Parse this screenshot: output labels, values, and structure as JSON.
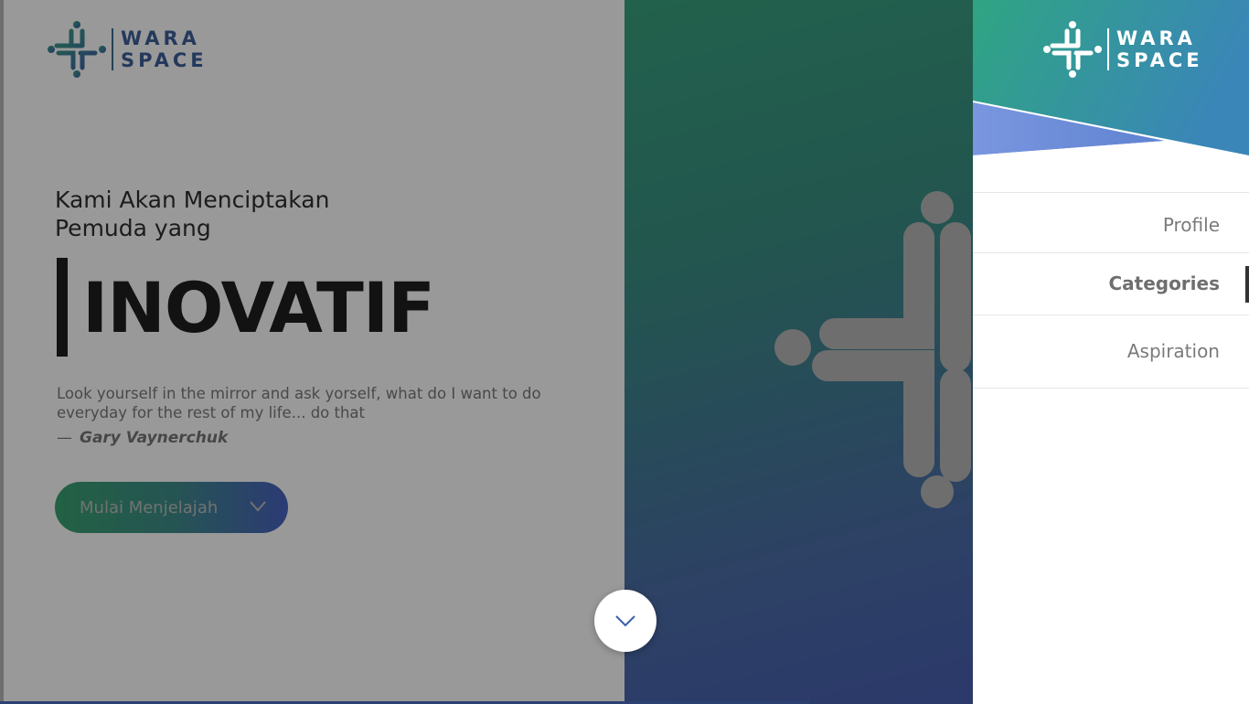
{
  "brand": {
    "name_line1": "WARA",
    "name_line2": "SPACE",
    "colors": {
      "teal": "#3aa37f",
      "blue": "#4a63c2",
      "dark_text": "#1e1e1e"
    }
  },
  "hero": {
    "tagline_line1": "Kami Akan Menciptakan",
    "tagline_line2": "Pemuda yang",
    "big_word": "INOVATIF",
    "quote": "Look yourself in the mirror and ask yorself, what do I want to do everyday for the rest of my life... do that",
    "author_dash": "—",
    "author": "Gary Vaynerchuk",
    "cta_label": "Mulai Menjelajah",
    "cta_icon": "chevron-down-icon",
    "scroll_icon": "chevron-down-icon"
  },
  "drawer": {
    "nav": [
      {
        "label": "Profile",
        "active": false
      },
      {
        "label": "Categories",
        "active": true
      },
      {
        "label": "Aspiration",
        "active": false
      }
    ]
  }
}
